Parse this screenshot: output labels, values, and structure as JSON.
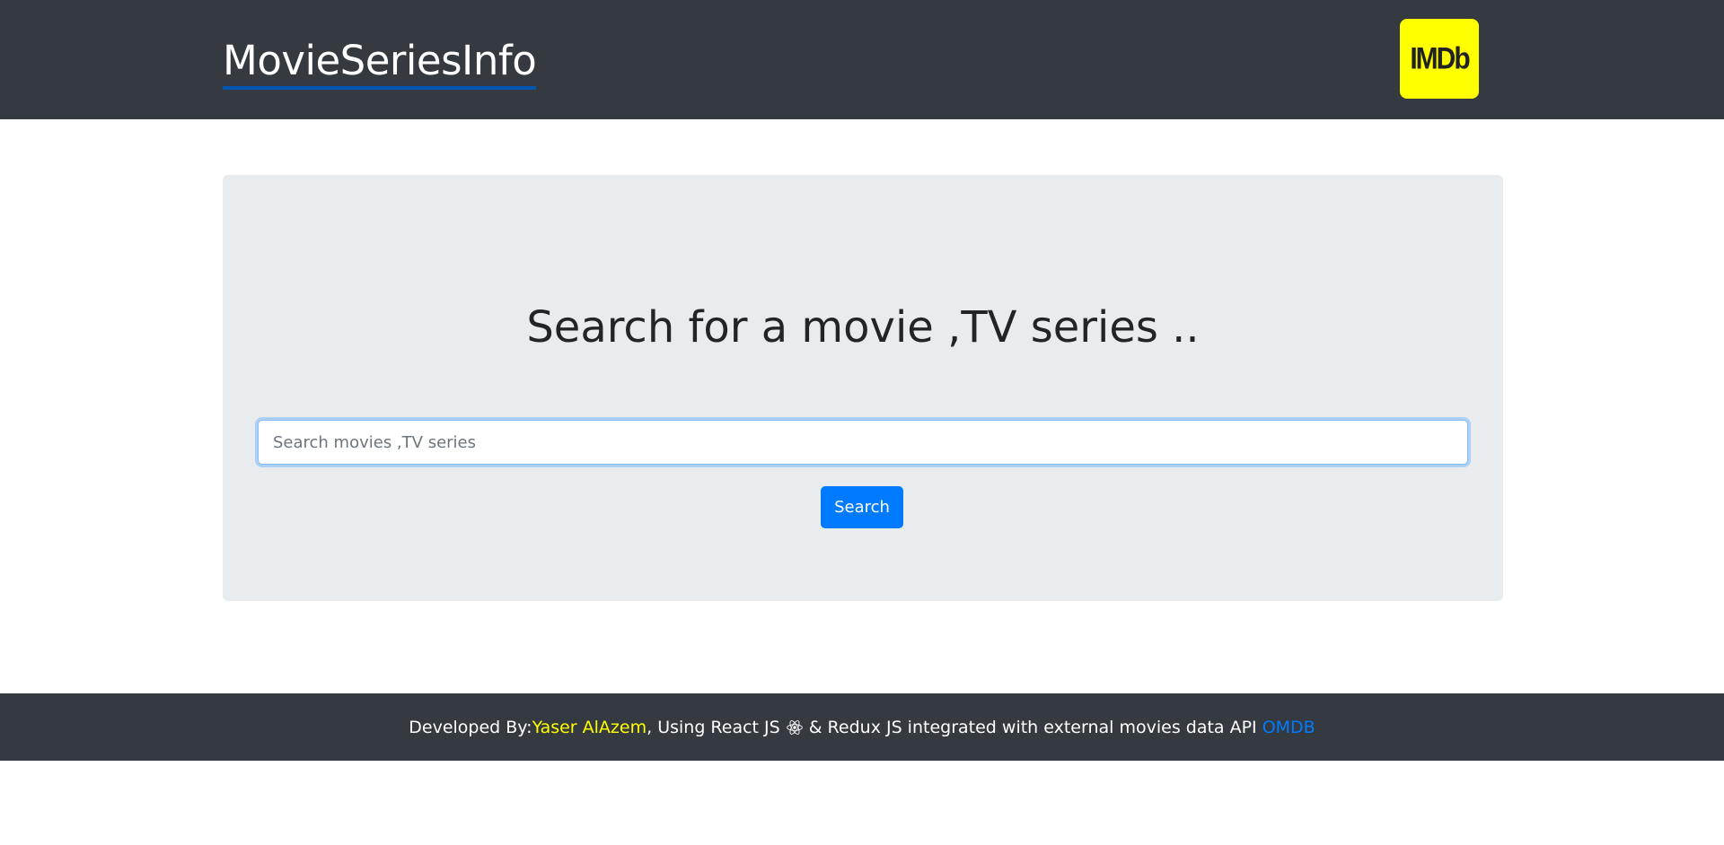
{
  "header": {
    "brand": "MovieSeriesInfo",
    "logo_text": "IMDb",
    "logo_icon": "imdb-logo"
  },
  "search": {
    "title": "Search for a movie ,TV series ..",
    "placeholder": "Search movies ,TV series",
    "value": "",
    "button_label": "Search"
  },
  "footer": {
    "prefix": "Developed By:",
    "author": "Yaser AlAzem",
    "middle_before_icon": ", Using React JS",
    "icon": "react-icon",
    "middle_after_icon": "& Redux JS integrated with external movies data API",
    "api_link": "OMDB"
  },
  "colors": {
    "navbar_bg": "#343a40",
    "jumbotron_bg": "#e9ecef",
    "primary": "#007bff",
    "imdb_yellow": "#ffff00",
    "author_yellow": "#ffff00"
  }
}
